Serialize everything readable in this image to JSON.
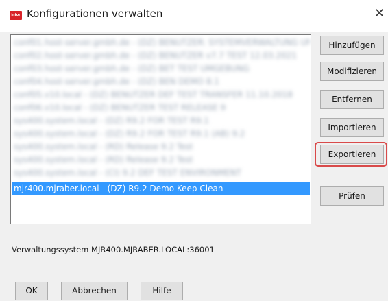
{
  "window": {
    "title": "Konfigurationen verwalten",
    "icon_text": "infor",
    "close_glyph": "✕"
  },
  "config_list": {
    "items": [
      {
        "label": "conf01.host-server.gmbh.de - (DZ) BENUTZER: SYSTEMVERWALTUNG UND K.",
        "blurred": true,
        "selected": false
      },
      {
        "label": "conf02.host-server.gmbh.de - (DZ) BENUTZER v7.7 TEST 12.03.2021",
        "blurred": true,
        "selected": false
      },
      {
        "label": "conf03.host-server.gmbh.de - (DZ) BET TEST UMGEBUNG",
        "blurred": true,
        "selected": false
      },
      {
        "label": "conf04.host-server.gmbh.de - (DZ) BEN DEMO 8.1",
        "blurred": true,
        "selected": false
      },
      {
        "label": "conf05.v10.local - (DZ) BENUTZER DEF TEST TRANSFER 11.10.2018",
        "blurred": true,
        "selected": false
      },
      {
        "label": "conf06.v10.local - (DZ) BENUTZER TEST RELEASE 9",
        "blurred": true,
        "selected": false
      },
      {
        "label": "sys400.system.local - (DZ) R9.2 FOR TEST R9.1",
        "blurred": true,
        "selected": false
      },
      {
        "label": "sys400.system.local - (DZ) R9.2 FOR TEST R9.1 (AB) 9.2",
        "blurred": true,
        "selected": false
      },
      {
        "label": "sys400.system.local - (RD) Release 9.2 Test",
        "blurred": true,
        "selected": false
      },
      {
        "label": "sys400.system.local - (RD) Release 9.2 Test",
        "blurred": true,
        "selected": false
      },
      {
        "label": "sys400.system.local - (CI) 9.2 DEF TEST ENVIRONMENT",
        "blurred": true,
        "selected": false
      },
      {
        "label": "mjr400.mjraber.local - (DZ) R9.2 Demo Keep Clean",
        "blurred": false,
        "selected": true
      }
    ]
  },
  "buttons": {
    "add": "Hinzufügen",
    "modify": "Modifizieren",
    "remove": "Entfernen",
    "import": "Importieren",
    "export": "Exportieren",
    "check": "Prüfen",
    "ok": "OK",
    "cancel": "Abbrechen",
    "help": "Hilfe"
  },
  "status": {
    "text": "Verwaltungssystem MJR400.MJRABER.LOCAL:36001"
  },
  "colors": {
    "selection": "#3399ff",
    "highlight_ring": "#d94a4a",
    "app_icon": "#d8232a"
  }
}
